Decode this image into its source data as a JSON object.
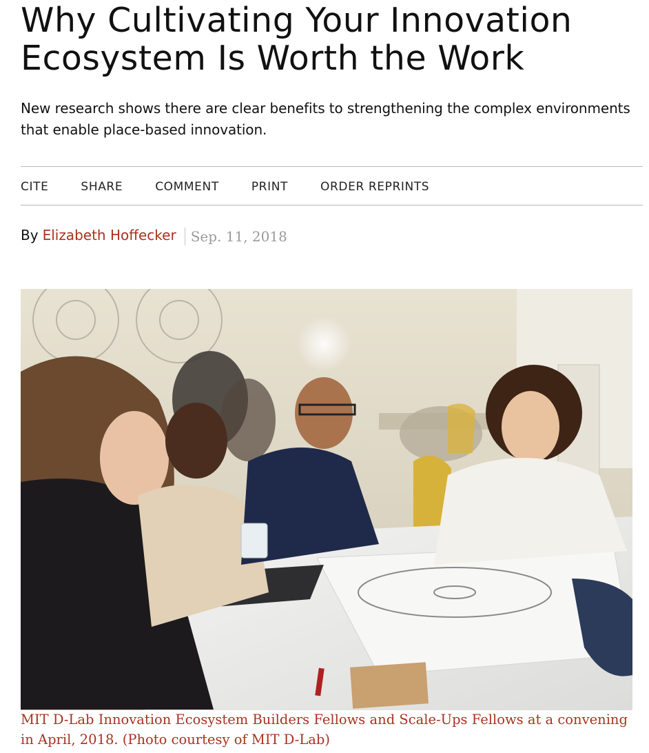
{
  "article": {
    "title_line1": "Why Cultivating Your Innovation",
    "title_line2": "Ecosystem Is Worth the Work",
    "dek": "New research shows there are clear benefits to strengthening the complex environments that enable place-based innovation."
  },
  "toolbar": {
    "items": [
      {
        "label": "CITE"
      },
      {
        "label": "SHARE"
      },
      {
        "label": "COMMENT"
      },
      {
        "label": "PRINT"
      },
      {
        "label": "ORDER REPRINTS"
      }
    ]
  },
  "byline": {
    "prefix": "By",
    "author": "Elizabeth Hoffecker",
    "date": "Sep. 11, 2018"
  },
  "figure": {
    "caption": "MIT D-Lab Innovation Ecosystem Builders Fellows and Scale-Ups Fellows at a convening in April, 2018. (Photo courtesy of MIT D-Lab)"
  },
  "colors": {
    "link": "#a8321f",
    "text": "#111111",
    "muted": "#9a9a9a",
    "rule": "#b8b8b8"
  }
}
